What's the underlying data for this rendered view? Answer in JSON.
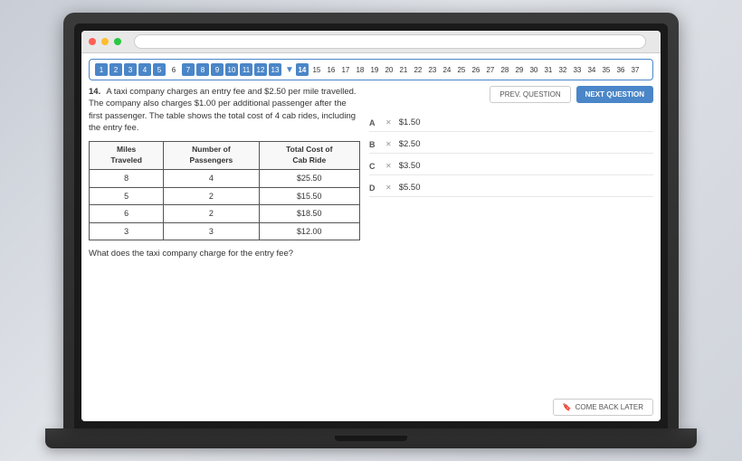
{
  "browser": {
    "dots": [
      "red",
      "yellow",
      "green"
    ]
  },
  "nav": {
    "numbers": [
      1,
      2,
      3,
      4,
      5,
      6,
      7,
      8,
      9,
      10,
      11,
      12,
      13,
      14,
      15,
      16,
      17,
      18,
      19,
      20,
      21,
      22,
      23,
      24,
      25,
      26,
      27,
      28,
      29,
      30,
      31,
      32,
      33,
      34,
      35,
      36,
      37
    ],
    "highlighted": [
      1,
      2,
      3,
      4,
      5,
      7,
      8,
      9,
      10,
      11,
      12,
      13
    ],
    "active": 14
  },
  "question": {
    "number": "14.",
    "text": "A taxi company charges an entry fee and $2.50 per mile travelled. The company also charges $1.00 per additional passenger after the first passenger. The table shows the total cost of 4 cab rides, including the entry fee.",
    "bottom_text": "What does the taxi company charge for the entry fee?"
  },
  "table": {
    "headers": [
      "Miles\nTraveled",
      "Number of\nPassengers",
      "Total Cost of\nCab Ride"
    ],
    "rows": [
      [
        "8",
        "4",
        "$25.50"
      ],
      [
        "5",
        "2",
        "$15.50"
      ],
      [
        "6",
        "2",
        "$18.50"
      ],
      [
        "3",
        "3",
        "$12.00"
      ]
    ]
  },
  "buttons": {
    "prev": "PREV. QUESTION",
    "next": "NEXT QUESTION",
    "come_back": "COME BACK LATER"
  },
  "answers": [
    {
      "letter": "A",
      "value": "$1.50"
    },
    {
      "letter": "B",
      "value": "$2.50"
    },
    {
      "letter": "C",
      "value": "$3.50"
    },
    {
      "letter": "D",
      "value": "$5.50"
    }
  ]
}
